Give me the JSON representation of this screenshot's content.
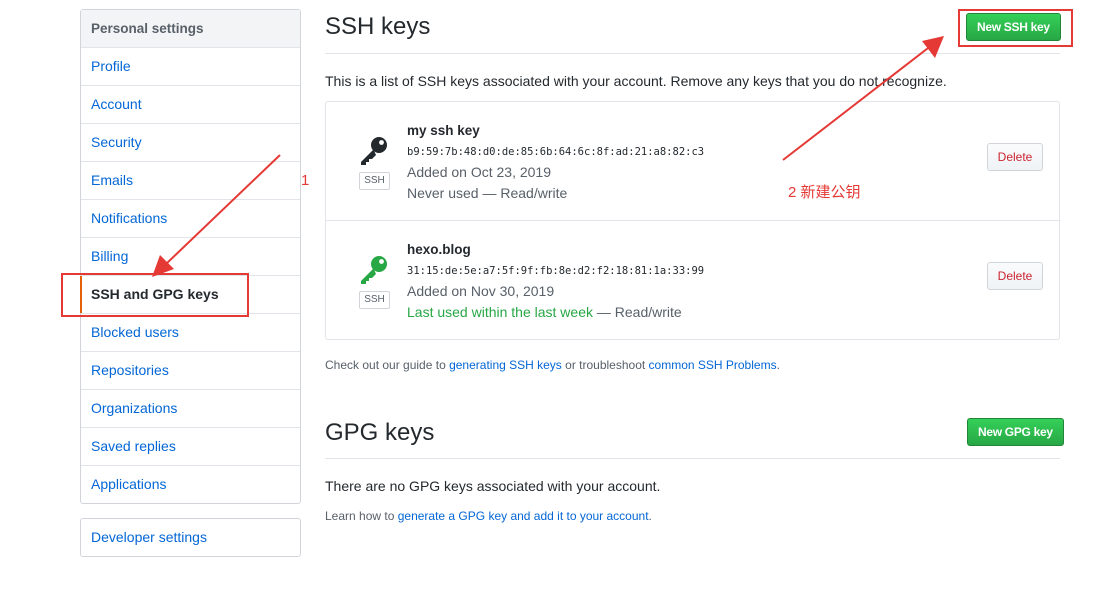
{
  "sidebar": {
    "heading": "Personal settings",
    "items": [
      {
        "label": "Profile"
      },
      {
        "label": "Account"
      },
      {
        "label": "Security"
      },
      {
        "label": "Emails"
      },
      {
        "label": "Notifications"
      },
      {
        "label": "Billing"
      },
      {
        "label": "SSH and GPG keys",
        "selected": true
      },
      {
        "label": "Blocked users"
      },
      {
        "label": "Repositories"
      },
      {
        "label": "Organizations"
      },
      {
        "label": "Saved replies"
      },
      {
        "label": "Applications"
      }
    ],
    "developer_settings": "Developer settings"
  },
  "ssh": {
    "title": "SSH keys",
    "new_button": "New SSH key",
    "description": "This is a list of SSH keys associated with your account. Remove any keys that you do not recognize.",
    "keys": [
      {
        "title": "my ssh key",
        "fingerprint": "b9:59:7b:48:d0:de:85:6b:64:6c:8f:ad:21:a8:82:c3",
        "added": "Added on Oct 23, 2019",
        "usage": "Never used",
        "access": " — Read/write",
        "label": "SSH",
        "icon": "key-icon-black",
        "delete_label": "Delete"
      },
      {
        "title": "hexo.blog",
        "fingerprint": "31:15:de:5e:a7:5f:9f:fb:8e:d2:f2:18:81:1a:33:99",
        "added": "Added on Nov 30, 2019",
        "usage": "Last used within the last week",
        "access": " — Read/write",
        "label": "SSH",
        "icon": "key-icon-green",
        "delete_label": "Delete"
      }
    ],
    "guide": {
      "prefix": "Check out our guide to ",
      "link1": "generating SSH keys",
      "middle": " or troubleshoot ",
      "link2": "common SSH Problems",
      "suffix": "."
    }
  },
  "gpg": {
    "title": "GPG keys",
    "new_button": "New GPG key",
    "empty": "There are no GPG keys associated with your account.",
    "learn": {
      "prefix": "Learn how to ",
      "link": "generate a GPG key and add it to your account",
      "suffix": "."
    }
  },
  "annotations": {
    "step1": "1",
    "step2": "2 新建公钥"
  },
  "colors": {
    "accent": "#e36209",
    "link": "#0366d6",
    "green": "#28a745",
    "danger": "#cb2431",
    "annotation": "#e53935"
  }
}
